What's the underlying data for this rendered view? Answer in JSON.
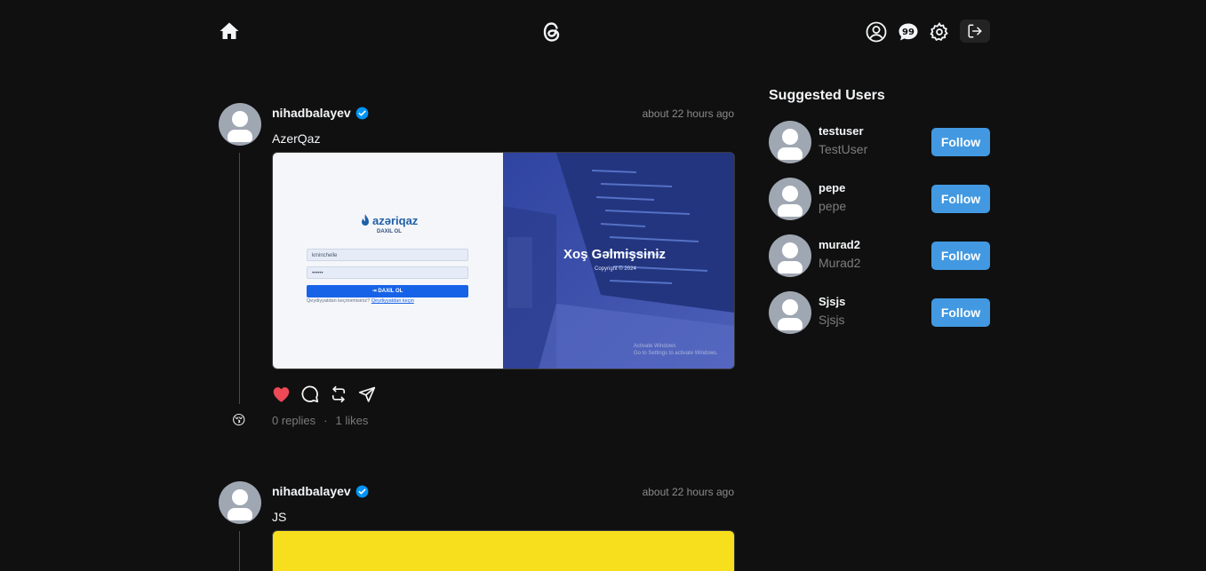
{
  "header": {
    "icons": [
      "home-icon",
      "threads-logo-icon",
      "profile-icon",
      "chat-icon",
      "settings-icon",
      "logout-icon"
    ]
  },
  "posts": [
    {
      "username": "nihadbalayev",
      "verified": true,
      "time": "about 22 hours ago",
      "text": "AzerQaz",
      "image": {
        "brand": "azəriqaz",
        "sub": "DAXIL OL",
        "username_value": "kminchelle",
        "password_value": "••••••",
        "button": "DAXIL OL",
        "footer_text": "Qeydiyyatdan keçməmisiniz?",
        "footer_link": "Qeydiyyatdan keçin",
        "welcome": "Xoş Gəlmişsiniz",
        "copyright": "Copyright © 2024",
        "activate_line1": "Activate Windows",
        "activate_line2": "Go to Settings to activate Windows."
      },
      "reply_emoji": "😚",
      "replies": "0 replies",
      "separator": "·",
      "likes": "1 likes",
      "liked": true
    },
    {
      "username": "nihadbalayev",
      "verified": true,
      "time": "about 22 hours ago",
      "text": "JS"
    }
  ],
  "suggested": {
    "title": "Suggested Users",
    "follow_label": "Follow",
    "users": [
      {
        "username": "testuser",
        "name": "TestUser"
      },
      {
        "username": "pepe",
        "name": "pepe"
      },
      {
        "username": "murad2",
        "name": "Murad2"
      },
      {
        "username": "Sjsjs",
        "name": "Sjsjs"
      }
    ]
  },
  "colors": {
    "background": "#101010",
    "follow": "#4299e1",
    "like": "#ed4956",
    "verified": "#0095f6"
  }
}
